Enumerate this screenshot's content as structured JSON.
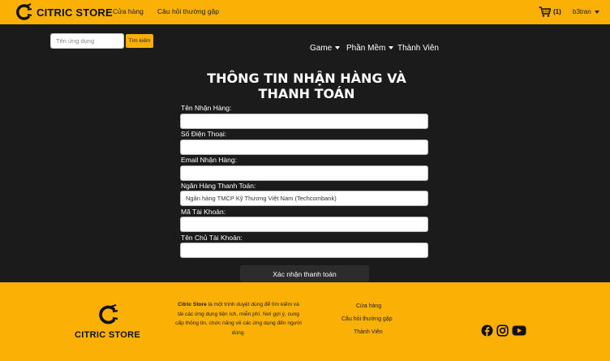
{
  "header": {
    "brand": "CITRIC STORE",
    "nav": [
      "Cửa hàng",
      "Câu hỏi thường gặp"
    ],
    "cart_count": "(1)",
    "user": "b3tran"
  },
  "search": {
    "placeholder": "Tên ứng dụng",
    "button": "Tìm kiếm"
  },
  "menu": [
    "Game",
    "Phần Mềm",
    "Thành Viên"
  ],
  "form": {
    "title": "THÔNG TIN NHẬN HÀNG VÀ THANH TOÁN",
    "fields": [
      {
        "label": "Tên Nhận Hàng:",
        "value": ""
      },
      {
        "label": "Số Điện Thoại:",
        "value": ""
      },
      {
        "label": "Email Nhận Hàng:",
        "value": ""
      },
      {
        "label": "Ngân Hàng Thanh Toán:",
        "value": "Ngân hàng TMCP Kỹ Thương Việt Nam (Techcombank)"
      },
      {
        "label": "Mã Tài Khoản:",
        "value": ""
      },
      {
        "label": "Tên Chủ Tài Khoản:",
        "value": ""
      }
    ],
    "submit": "Xác nhận thanh toán"
  },
  "footer": {
    "brand": "CITRIC STORE",
    "desc_brand": "Citric Store",
    "desc_text": " là một trình duyệt dùng để tìm kiếm và tải các ứng dụng tiện ích, miễn phí. Nơi gợi ý, cung cấp thông tin, chức năng về các ứng dụng đến người dùng.",
    "links": [
      "Cửa hàng",
      "Câu hỏi thường gặp",
      "Thành Viên"
    ]
  },
  "colors": {
    "accent": "#fbb005",
    "background": "#1b1b1b"
  },
  "icons": [
    "cart-icon",
    "facebook-icon",
    "instagram-icon",
    "youtube-icon"
  ]
}
